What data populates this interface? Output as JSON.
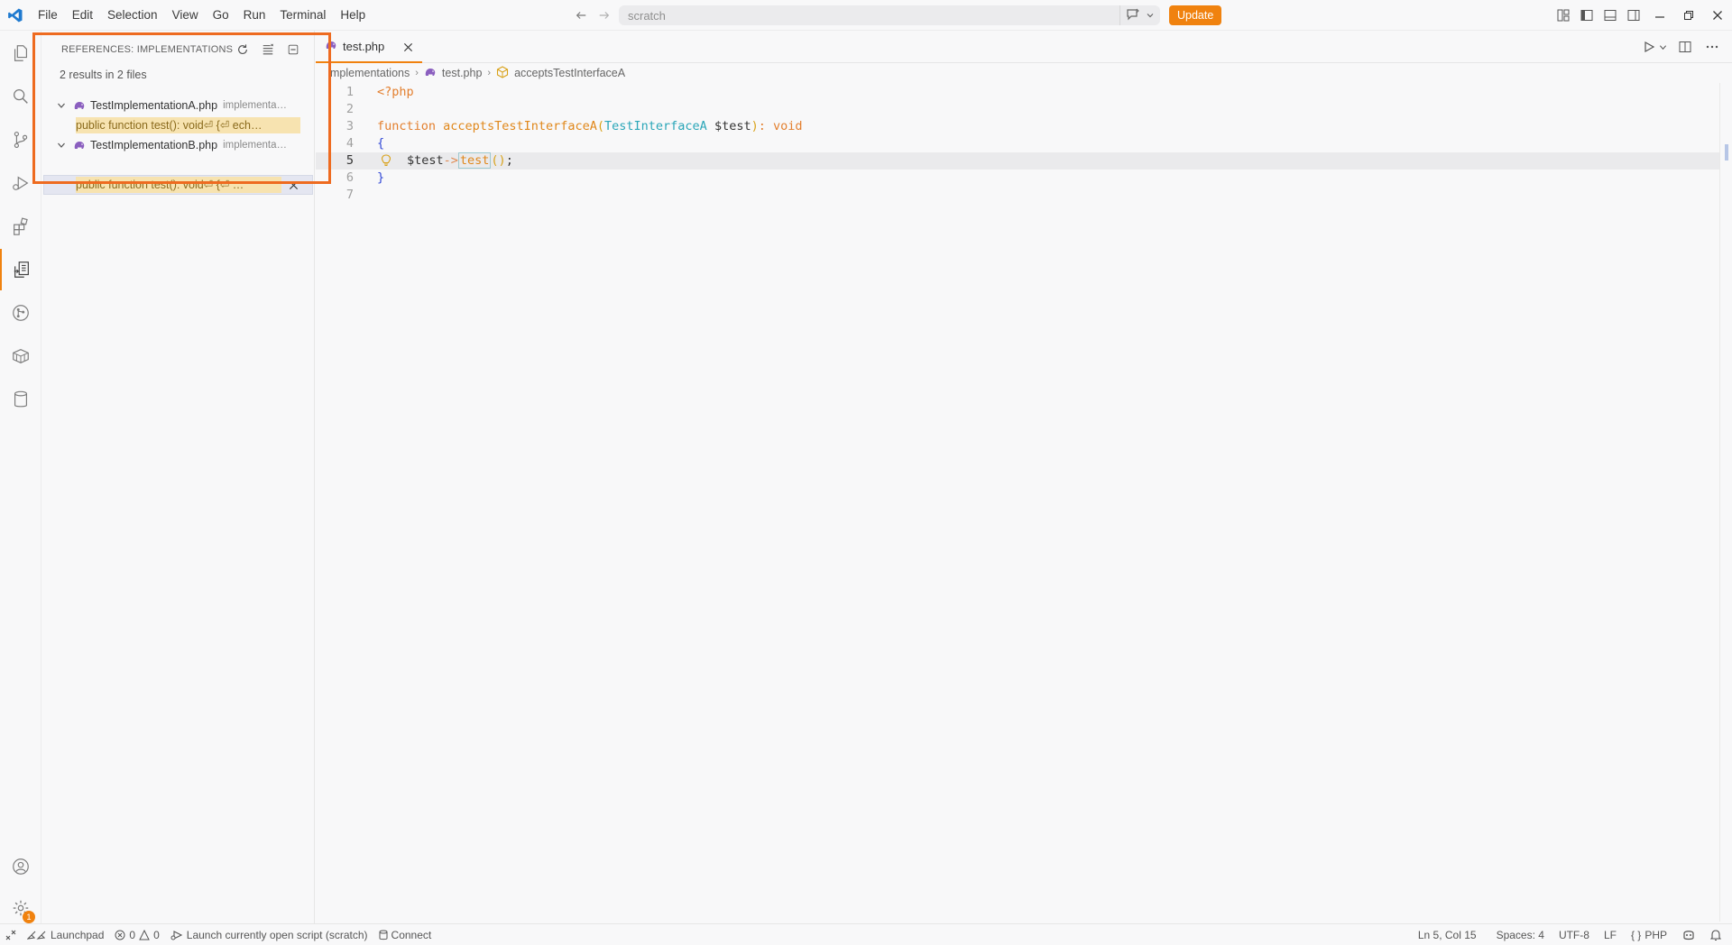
{
  "titlebar": {
    "menu": [
      "File",
      "Edit",
      "Selection",
      "View",
      "Go",
      "Run",
      "Terminal",
      "Help"
    ],
    "search_placeholder": "scratch",
    "update_label": "Update"
  },
  "sidebar": {
    "title": "REFERENCES: IMPLEMENTATIONS",
    "summary": "2 results in 2 files",
    "files": [
      {
        "name": "TestImplementationA.php",
        "path": "implementa…",
        "match": "public function test(): void⏎ {⏎ ech…"
      },
      {
        "name": "TestImplementationB.php",
        "path": "implementa…",
        "match": "public function test(): void⏎ {⏎  …"
      }
    ]
  },
  "editor": {
    "tab_label": "test.php",
    "breadcrumb": [
      "mplementations",
      "test.php",
      "acceptsTestInterfaceA"
    ],
    "lines": [
      {
        "n": "1"
      },
      {
        "n": "2"
      },
      {
        "n": "3"
      },
      {
        "n": "4"
      },
      {
        "n": "5"
      },
      {
        "n": "6"
      },
      {
        "n": "7"
      }
    ],
    "code": {
      "l1_open": "<?php",
      "l3_kw": "function",
      "l3_fn": "acceptsTestInterfaceA",
      "l3_paren_open": "(",
      "l3_type": "TestInterfaceA",
      "l3_var": "$test",
      "l3_paren_close": ")",
      "l3_colon": ":",
      "l3_ret": "void",
      "l4_brace": "{",
      "l5_var": "$test",
      "l5_arrow": "->",
      "l5_method": "test",
      "l5_parens": "()",
      "l5_semi": ";",
      "l6_brace": "}"
    }
  },
  "statusbar": {
    "launchpad": "Launchpad",
    "errors": "0",
    "warnings": "0",
    "launch_script": "Launch currently open script (scratch)",
    "connect": "Connect",
    "position": "Ln 5, Col 15",
    "spaces": "Spaces: 4",
    "encoding": "UTF-8",
    "eol": "LF",
    "language": "PHP",
    "language_prefix": "{ }"
  },
  "badges": {
    "settings_count": "1"
  },
  "colors": {
    "accent": "#f0820f",
    "highlight_box": "#ee6b20",
    "match_bg": "#f7e3b0"
  }
}
